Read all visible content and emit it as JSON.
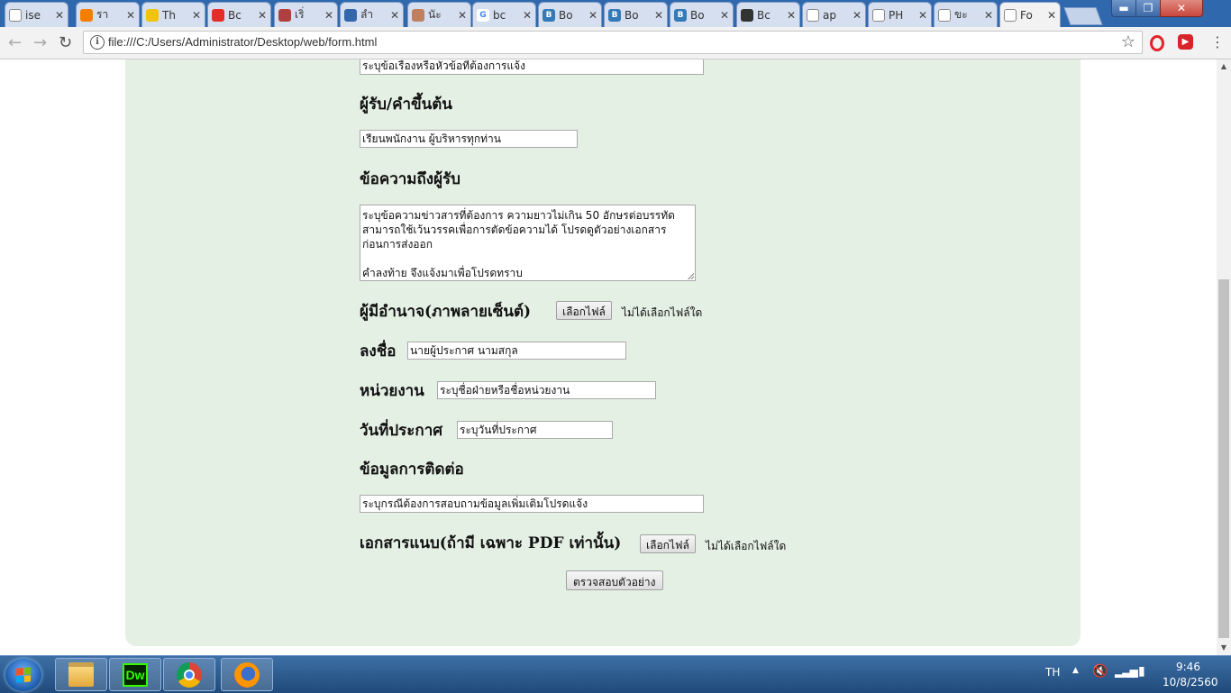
{
  "browser": {
    "tabs": [
      {
        "label": "ise",
        "icon": "generic-page-icon",
        "color": "#888888"
      },
      {
        "label": "รา",
        "icon": "blogger-icon",
        "color": "#f57d00"
      },
      {
        "label": "Th",
        "icon": "emoji-icon",
        "color": "#f2c20f"
      },
      {
        "label": "Bc",
        "icon": "youtube-icon",
        "color": "#e52d27"
      },
      {
        "label": "เริ่",
        "icon": "bookmark-icon",
        "color": "#b04040"
      },
      {
        "label": "ลำ",
        "icon": "msn-icon",
        "color": "#3366aa"
      },
      {
        "label": "นัะ",
        "icon": "avatar-icon",
        "color": "#c08060"
      },
      {
        "label": "bc",
        "icon": "google-icon",
        "color": "#4285f4"
      },
      {
        "label": "Bo",
        "icon": "bootstrap-icon",
        "color": "#337ab7"
      },
      {
        "label": "Bo",
        "icon": "bootstrap-icon",
        "color": "#337ab7"
      },
      {
        "label": "Bo",
        "icon": "bootstrap-icon",
        "color": "#337ab7"
      },
      {
        "label": "Bc",
        "icon": "codepen-icon",
        "color": "#333333"
      },
      {
        "label": "ap",
        "icon": "generic-page-icon",
        "color": "#888888"
      },
      {
        "label": "PH",
        "icon": "generic-page-icon",
        "color": "#888888"
      },
      {
        "label": "ขะ",
        "icon": "generic-page-icon",
        "color": "#888888"
      },
      {
        "label": "Fo",
        "icon": "generic-page-icon",
        "color": "#888888",
        "active": true
      }
    ],
    "url": "file:///C:/Users/Administrator/Desktop/web/form.html"
  },
  "form": {
    "subject_value": "ระบุข้อเรื่องหรือหัวข้อที่ต้องการแจ้ง",
    "recipient_label": "ผู้รับ/คำขึ้นต้น",
    "recipient_value": "เรียนพนักงาน ผู้บริหารทุกท่าน",
    "message_label": "ข้อความถึงผู้รับ",
    "message_value": "ระบุข้อความข่าวสารที่ต้องการ ความยาวไม่เกิน 50 อักษรต่อบรรทัด\nสามารถใช้เว้นวรรคเพื่อการตัดข้อความได้ โปรดดูตัวอย่างเอกสาร\nก่อนการส่งออก\n\nคำลงท้าย จึงแจ้งมาเพื่อโปรดทราบ",
    "authority_label": "ผู้มีอำนาจ(ภาพลายเซ็นต์)",
    "choose_file_label": "เลือกไฟล์",
    "no_file_label": "ไม่ได้เลือกไฟล์ใด",
    "signer_label": "ลงชื่อ",
    "signer_value": "นายผู้ประกาศ นามสกุล",
    "department_label": "หน่วยงาน",
    "department_value": "ระบุชื่อฝ่ายหรือชื่อหน่วยงาน",
    "date_label": "วันที่ประกาศ",
    "date_value": "ระบุวันที่ประกาศ",
    "contact_label": "ข้อมูลการติดต่อ",
    "contact_value": "ระบุกรณีต้องการสอบถามข้อมูลเพิ่มเติมโปรดแจ้ง",
    "attachment_label": "เอกสารแนบ(ถ้ามี เฉพาะ PDF เท่านั้น)",
    "attachment_choose_label": "เลือกไฟล์",
    "attachment_no_file_label": "ไม่ได้เลือกไฟล์ใด",
    "preview_button_label": "ตรวจสอบตัวอย่าง"
  },
  "taskbar": {
    "language": "TH",
    "time": "9:46",
    "date": "10/8/2560",
    "apps": [
      "file-explorer-icon",
      "dreamweaver-icon",
      "chrome-icon",
      "firefox-icon"
    ],
    "dreamweaver_text": "Dw"
  },
  "colors": {
    "panel_background": "#e5f0e4",
    "tabstrip": "#2f68ad",
    "close_button": "#c9463d"
  }
}
